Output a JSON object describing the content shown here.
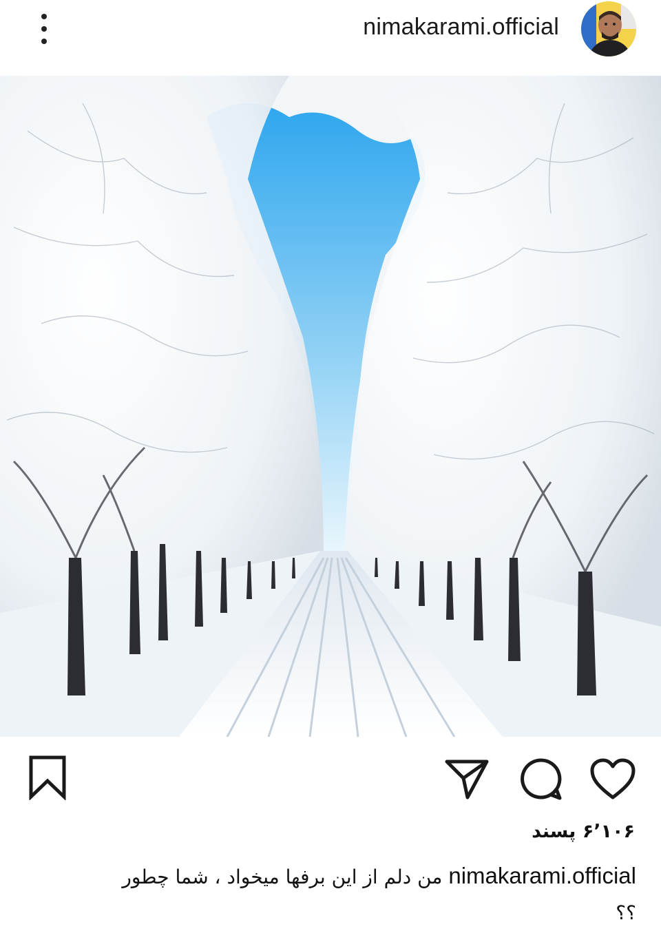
{
  "header": {
    "username": "nimakarami.official",
    "more_icon": "more-vertical-icon",
    "avatar_icon": "profile-avatar"
  },
  "post": {
    "image_subject": "snow-covered-tree-lined-road",
    "actions": {
      "like_icon": "heart-icon",
      "comment_icon": "comment-icon",
      "share_icon": "send-icon",
      "save_icon": "bookmark-icon"
    },
    "likes_text": "۶٬۱۰۶ پسند",
    "caption": {
      "username": "nimakarami.official",
      "text": "من دلم از این برفها میخواد ، شما چطور ؟؟"
    }
  },
  "colors": {
    "sky": "#3fb0ef",
    "snow": "#f4f8fc",
    "bark": "#2c2c33",
    "avatar_bg": "#f3d34a"
  }
}
